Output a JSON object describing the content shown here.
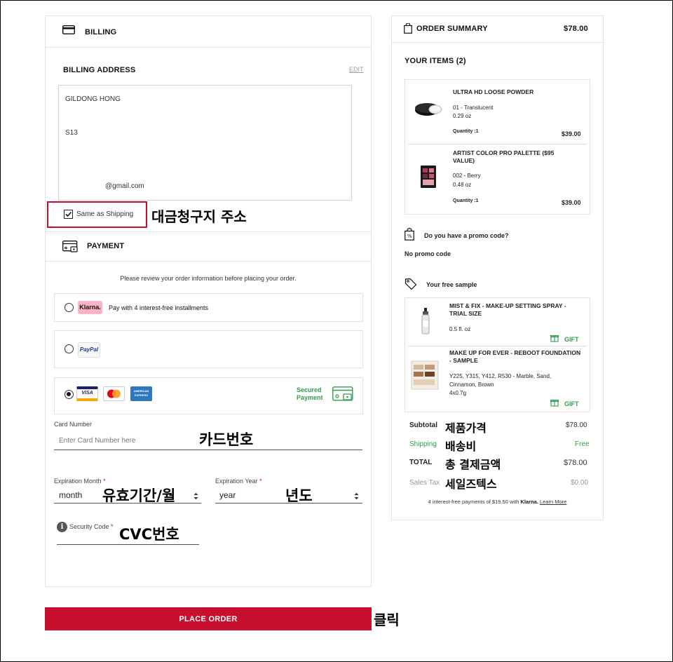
{
  "billing": {
    "section_title": "BILLING",
    "address_title": "BILLING ADDRESS",
    "edit_link": "EDIT",
    "name": "GILDONG HONG",
    "address_line": "S13",
    "email": "@gmail.com",
    "same_as_shipping_label": "Same as Shipping",
    "same_as_shipping_checked": true,
    "annotation": "대금청구지 주소"
  },
  "payment": {
    "section_title": "PAYMENT",
    "notice": "Please review your order information before placing your order.",
    "klarna_badge": "Klarna.",
    "klarna_text": "Pay with 4 interest-free installments",
    "paypal_badge": "PayPal",
    "visa_label": "VISA",
    "amex_label": "AMERICAN EXPRESS",
    "secured_line1": "Secured",
    "secured_line2": "Payment",
    "selected_method": "card",
    "card_number_label": "Card Number",
    "card_number_placeholder": "Enter Card Number here",
    "card_number_annotation": "카드번호",
    "exp_month_label": "Expiration Month",
    "exp_month_value": "month",
    "exp_month_annotation": "유효기간/월",
    "exp_year_label": "Expiration Year",
    "exp_year_value": "year",
    "exp_year_annotation": "년도",
    "required_mark": "*",
    "security_code_label": "Security Code",
    "security_code_annotation": "CVC번호"
  },
  "place_order": {
    "label": "PLACE ORDER",
    "annotation": "클릭"
  },
  "summary": {
    "title": "ORDER SUMMARY",
    "total_header": "$78.00",
    "your_items": "YOUR ITEMS (2)",
    "items": [
      {
        "name": "ULTRA HD LOOSE POWDER",
        "variant": "01 - Translucent",
        "size": "0.29 oz",
        "quantity": "Quantity :1",
        "price": "$39.00"
      },
      {
        "name": "ARTIST COLOR PRO PALETTE ($95 VALUE)",
        "variant": "002 - Berry",
        "size": "0.48 oz",
        "quantity": "Quantity :1",
        "price": "$39.00"
      }
    ],
    "promo_question": "Do you have a promo code?",
    "promo_value": "No promo code",
    "free_sample_title": "Your free sample",
    "samples": [
      {
        "name": "MIST & FIX - MAKE-UP SETTING SPRAY - TRIAL SIZE",
        "detail": "0.5 fl. oz",
        "gift_label": "GIFT"
      },
      {
        "name": "MAKE UP FOR EVER - REBOOT FOUNDATION - SAMPLE",
        "detail": "Y225, Y315, Y412, R530 - Marble, Sand, Cinnamon, Brown",
        "detail2": "4x0.7g",
        "gift_label": "GIFT"
      }
    ],
    "subtotal_label": "Subtotal",
    "subtotal_value": "$78.00",
    "subtotal_annotation": "제품가격",
    "shipping_label": "Shipping",
    "shipping_value": "Free",
    "shipping_annotation": "배송비",
    "total_label": "TOTAL",
    "total_value": "$78.00",
    "total_annotation": "총 결제금액",
    "tax_label": "Sales Tax",
    "tax_value": "$0.00",
    "tax_annotation": "세일즈텍스",
    "klarna_note": "4 interest-free payments of $19.50 with",
    "klarna_brand": "Klarna.",
    "learn_more": "Learn More"
  },
  "colors": {
    "accent_red": "#c8102e",
    "highlight_box": "#c8102e",
    "gift_green": "#2e9d4c",
    "klarna_pink": "#ffb3c7"
  },
  "icons": [
    "credit-card-icon",
    "payment-card-icon",
    "shopping-bag-icon",
    "promo-bag-icon",
    "tag-icon",
    "gift-icon",
    "info-icon",
    "select-arrows-icon"
  ]
}
